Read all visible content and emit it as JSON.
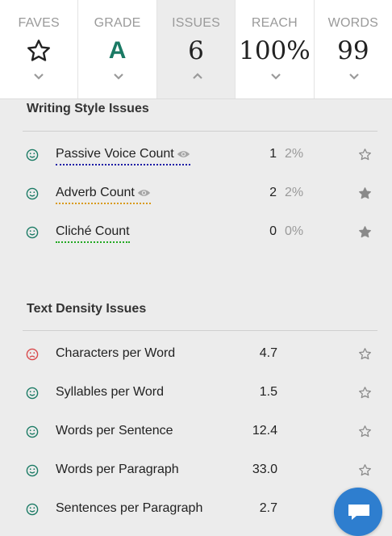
{
  "tabs": [
    {
      "label": "FAVES",
      "icon": "star-outline-icon",
      "value": "",
      "expanded": false
    },
    {
      "label": "GRADE",
      "value": "A",
      "expanded": false
    },
    {
      "label": "ISSUES",
      "value": "6",
      "expanded": true
    },
    {
      "label": "REACH",
      "value": "100%",
      "expanded": false
    },
    {
      "label": "WORDS",
      "value": "99",
      "expanded": false
    }
  ],
  "writing_style": {
    "title": "Writing Style Issues",
    "items": [
      {
        "name": "Passive Voice Count",
        "count": "1",
        "pct": "2%",
        "status": "good",
        "eye": true,
        "underline": "#1a1aa6",
        "starred": false
      },
      {
        "name": "Adverb Count",
        "count": "2",
        "pct": "2%",
        "status": "good",
        "eye": true,
        "underline": "#d99a1a",
        "starred": true
      },
      {
        "name": "Cliché Count",
        "count": "0",
        "pct": "0%",
        "status": "good",
        "eye": false,
        "underline": "#22a822",
        "starred": true
      }
    ]
  },
  "text_density": {
    "title": "Text Density Issues",
    "items": [
      {
        "name": "Characters per Word",
        "value": "4.7",
        "status": "bad",
        "starred": false
      },
      {
        "name": "Syllables per Word",
        "value": "1.5",
        "status": "good",
        "starred": false
      },
      {
        "name": "Words per Sentence",
        "value": "12.4",
        "status": "good",
        "starred": false
      },
      {
        "name": "Words per Paragraph",
        "value": "33.0",
        "status": "good",
        "starred": false
      },
      {
        "name": "Sentences per Paragraph",
        "value": "2.7",
        "status": "good",
        "starred": false
      }
    ]
  },
  "colors": {
    "good": "#1a7a64",
    "bad": "#d9484a",
    "accent": "#2e7ecf"
  }
}
